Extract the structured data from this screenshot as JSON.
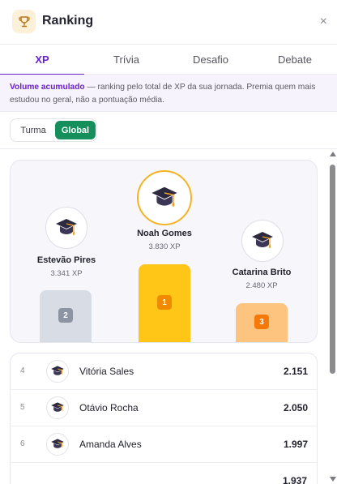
{
  "header": {
    "title": "Ranking",
    "icon": "trophy-icon",
    "close_label": "×"
  },
  "tabs": [
    {
      "label": "XP",
      "active": true
    },
    {
      "label": "Trívia",
      "active": false
    },
    {
      "label": "Desafio",
      "active": false
    },
    {
      "label": "Debate",
      "active": false
    }
  ],
  "info": {
    "title": "Volume acumulado",
    "text": " — ranking pelo total de XP da sua jornada. Premia quem mais estudou no geral, não a pontuação média."
  },
  "scope_toggle": {
    "options": [
      "Turma",
      "Global"
    ],
    "selected": "Global"
  },
  "podium": [
    {
      "rank": "2",
      "name": "Estevão Pires",
      "xp": "3.341 XP",
      "medal": "silver"
    },
    {
      "rank": "1",
      "name": "Noah Gomes",
      "xp": "3.830 XP",
      "medal": "gold"
    },
    {
      "rank": "3",
      "name": "Catarina Brito",
      "xp": "2.480 XP",
      "medal": "bronze"
    }
  ],
  "list": [
    {
      "pos": "4",
      "name": "Vitória Sales",
      "score": "2.151"
    },
    {
      "pos": "5",
      "name": "Otávio Rocha",
      "score": "2.050"
    },
    {
      "pos": "6",
      "name": "Amanda Alves",
      "score": "1.997"
    }
  ],
  "list_partial_score": "1.937",
  "colors": {
    "accent": "#6b21c9",
    "global_toggle": "#15905c",
    "gold": "#ffc617",
    "silver": "#d8dce4",
    "bronze": "#fcc47f"
  },
  "avatar_icon": "graduation-cap-icon"
}
